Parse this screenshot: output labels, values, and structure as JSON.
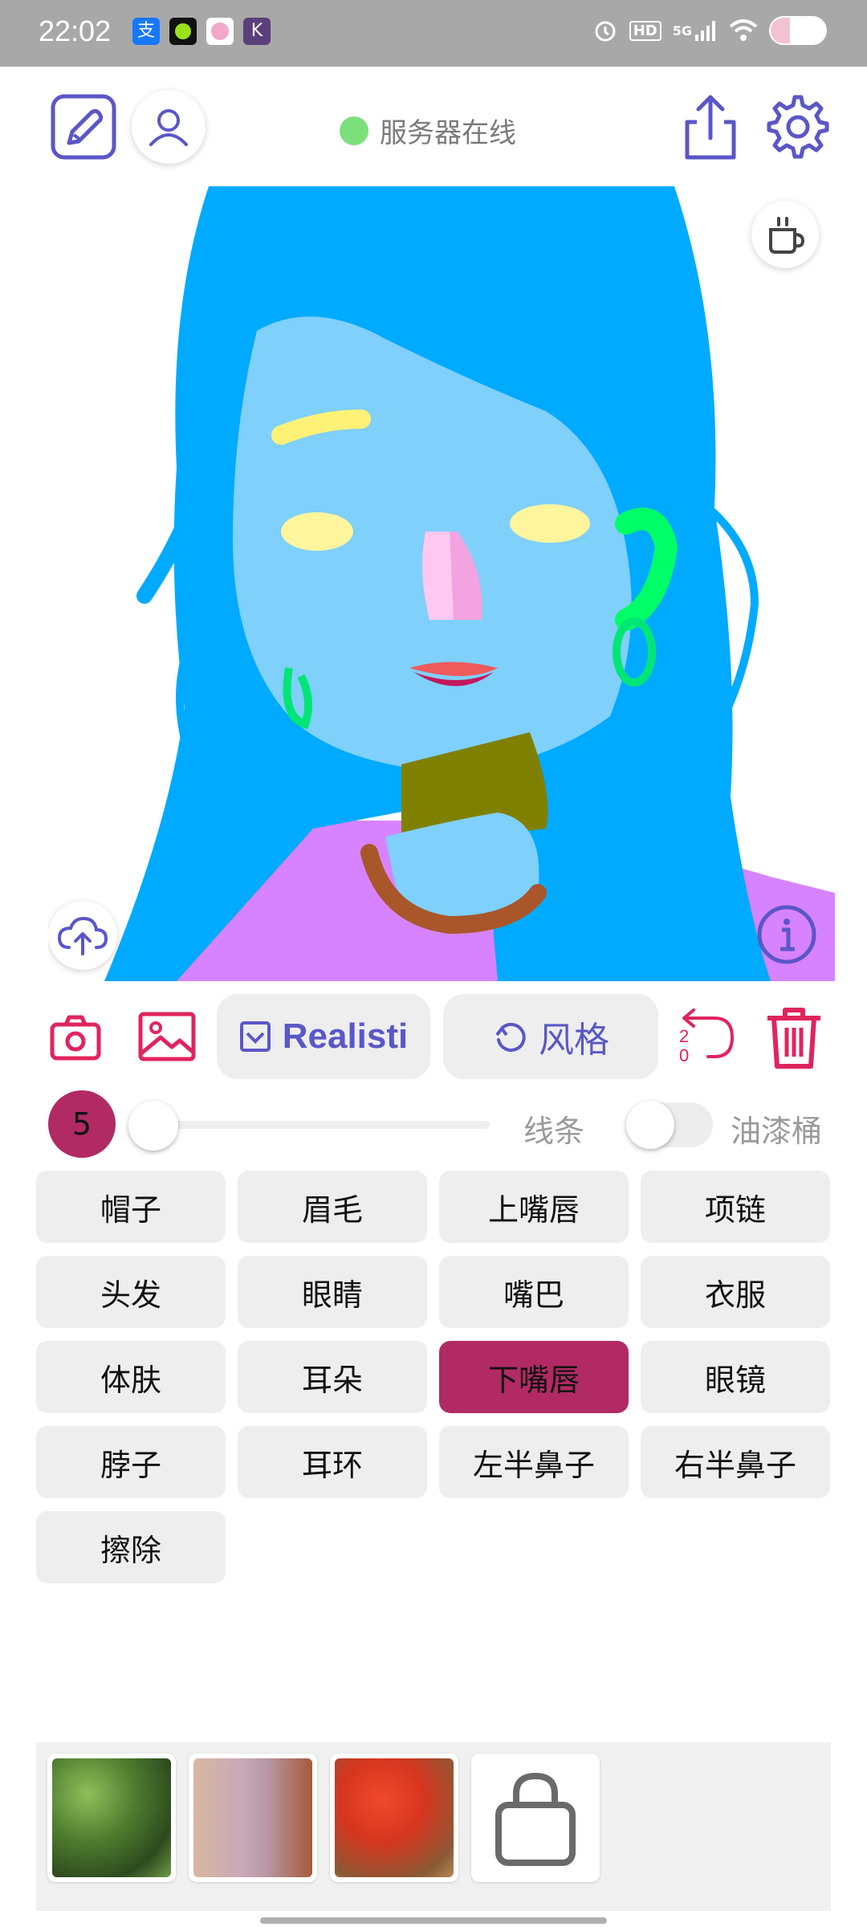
{
  "status_bar": {
    "time": "22:02",
    "apps": [
      {
        "icon": "alipay-icon",
        "glyph": "支",
        "color": "#1677ff"
      },
      {
        "icon": "app-green-icon",
        "glyph": "●",
        "color": "#111111"
      },
      {
        "icon": "app-pink-icon",
        "glyph": "◉",
        "color": "#f4a6c9"
      },
      {
        "icon": "app-k-icon",
        "glyph": "K",
        "color": "#5b3f7a"
      }
    ],
    "network_hd": "HD",
    "network_5g": "5G",
    "battery_level": 0.35
  },
  "header": {
    "online_status": "服务器在线",
    "online_color": "#7be07b"
  },
  "toolbar": {
    "model_label": "Realisti",
    "style_label": "风格",
    "undo_count_top": "2",
    "undo_count_bottom": "0"
  },
  "brush": {
    "size": "5",
    "size_value": 5,
    "line_label": "线条",
    "bucket_label": "油漆桶",
    "bucket_on": false
  },
  "parts": [
    {
      "label": "帽子",
      "selected": false
    },
    {
      "label": "眉毛",
      "selected": false
    },
    {
      "label": "上嘴唇",
      "selected": false
    },
    {
      "label": "项链",
      "selected": false
    },
    {
      "label": "头发",
      "selected": false
    },
    {
      "label": "眼睛",
      "selected": false
    },
    {
      "label": "嘴巴",
      "selected": false
    },
    {
      "label": "衣服",
      "selected": false
    },
    {
      "label": "体肤",
      "selected": false
    },
    {
      "label": "耳朵",
      "selected": false
    },
    {
      "label": "下嘴唇",
      "selected": true
    },
    {
      "label": "眼镜",
      "selected": false
    },
    {
      "label": "脖子",
      "selected": false
    },
    {
      "label": "耳环",
      "selected": false
    },
    {
      "label": "左半鼻子",
      "selected": false
    },
    {
      "label": "右半鼻子",
      "selected": false
    },
    {
      "label": "擦除",
      "selected": false
    }
  ],
  "colors": {
    "accent": "#5b56c8",
    "selected_part": "#b12a64",
    "danger": "#e0245e"
  },
  "gallery": [
    {
      "icon": "green-foliage-thumbnail"
    },
    {
      "icon": "lace-fabric-thumbnail"
    },
    {
      "icon": "red-flowers-thumbnail"
    },
    {
      "icon": "shopping-bag-icon"
    }
  ]
}
